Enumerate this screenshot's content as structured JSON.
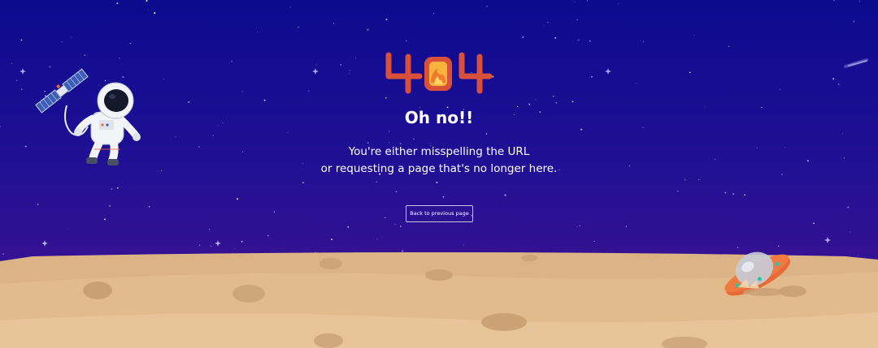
{
  "error_page": {
    "code": "404",
    "title": "Oh no!!",
    "message_line1": "You're either misspelling the URL",
    "message_line2": "or requesting a page that's no longer here.",
    "back_button_label": "Back to previous page"
  },
  "colors": {
    "sky_top": "#0d0a8e",
    "sky_bottom": "#3d1390",
    "ground": "#e2b98a",
    "logo_orange": "#d9503a",
    "logo_fire": "#f2a63a",
    "ufo_orange": "#e86a36"
  },
  "illustrations": {
    "astronaut": "astronaut-with-satellite",
    "ufo": "crashed-ufo",
    "comet": "shooting-star"
  }
}
